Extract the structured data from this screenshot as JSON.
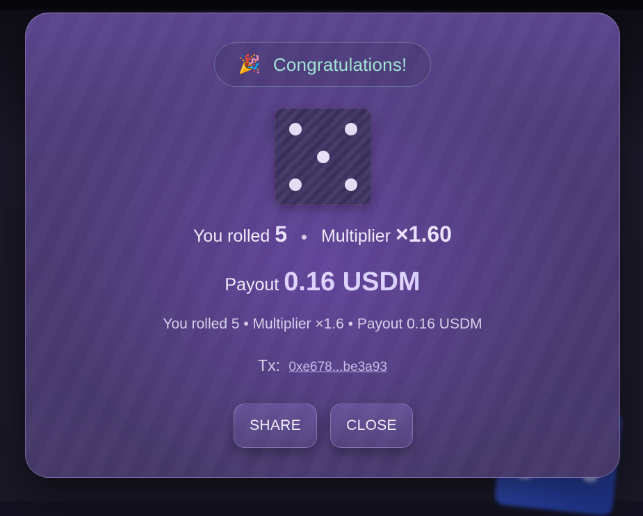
{
  "modal": {
    "header": {
      "icon": "party-popper-icon",
      "title": "Congratulations!"
    },
    "die": {
      "value": 5,
      "icon": "die-five-icon"
    },
    "roll_line": {
      "prefix": "You rolled",
      "roll": "5",
      "multiplier_label": "Multiplier",
      "multiplier_value": "×1.60"
    },
    "payout_line": {
      "label": "Payout",
      "value": "0.16 USDM"
    },
    "summary": "You rolled 5 • Multiplier ×1.6 • Payout 0.16 USDM",
    "tx": {
      "label": "Tx:",
      "hash": "0xe678...be3a93"
    },
    "buttons": {
      "share": "SHARE",
      "close": "CLOSE"
    }
  },
  "colors": {
    "accent_title": "#9fe6d2",
    "payout_value": "#ddd3ff",
    "modal_bg": "#4e3d7a"
  }
}
